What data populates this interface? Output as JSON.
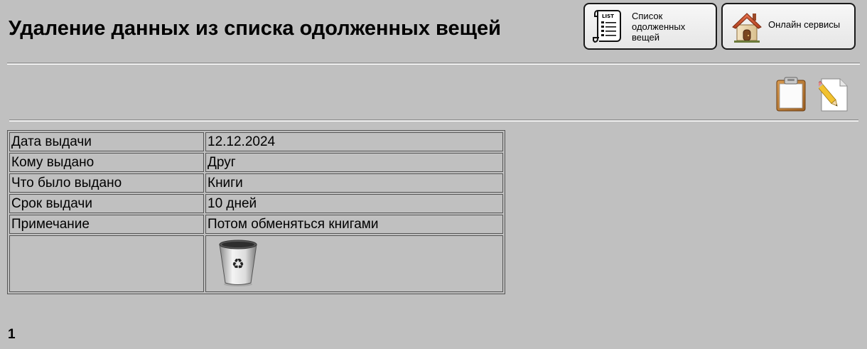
{
  "header": {
    "title": "Удаление данных из списка одолженных вещей"
  },
  "nav": {
    "list_button_label": "Список одолженных вещей",
    "list_button_icon": "list-scroll-icon",
    "home_button_label": "Онлайн сервисы",
    "home_button_icon": "house-icon"
  },
  "toolbar": {
    "icons": [
      "clipboard-icon",
      "edit-document-icon"
    ]
  },
  "record": {
    "rows": [
      {
        "label": "Дата выдачи",
        "value": "12.12.2024"
      },
      {
        "label": "Кому выдано",
        "value": "Друг"
      },
      {
        "label": "Что было выдано",
        "value": "Книги"
      },
      {
        "label": "Срок выдачи",
        "value": "10 дней"
      },
      {
        "label": "Примечание",
        "value": "Потом обменяться книгами"
      }
    ],
    "delete_icon": "recycle-bin-icon"
  },
  "pagination": {
    "current_page": "1"
  },
  "colors": {
    "background": "#c0c0c0",
    "border": "#555555"
  }
}
